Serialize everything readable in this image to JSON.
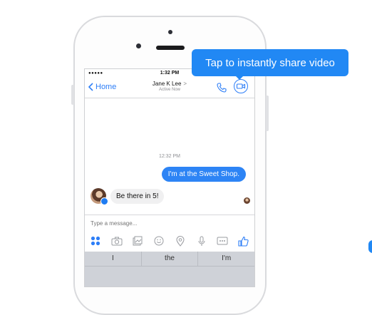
{
  "status_bar": {
    "signal": "●●●●● ",
    "time": "1:32 PM"
  },
  "header": {
    "back_label": "Home",
    "contact_name": "Jane K Lee",
    "contact_chevron": ">",
    "contact_status": "Active Now"
  },
  "tooltip": {
    "text": "Tap to instantly share video"
  },
  "conversation": {
    "timestamp": "12:32 PM",
    "outgoing": "I'm at the Sweet Shop.",
    "incoming": "Be there in 5!"
  },
  "composer": {
    "placeholder": "Type a message..."
  },
  "toolbar_icons": [
    "apps-icon",
    "camera-icon",
    "gallery-icon",
    "emoji-icon",
    "location-icon",
    "microphone-icon",
    "more-icon",
    "like-icon"
  ],
  "keyboard": {
    "suggestions": [
      "I",
      "the",
      "I'm"
    ]
  },
  "colors": {
    "accent": "#2188f4",
    "bubble_out": "#2d84f5",
    "bubble_in": "#f0f0f1",
    "keyboard": "#cfd2d8"
  }
}
